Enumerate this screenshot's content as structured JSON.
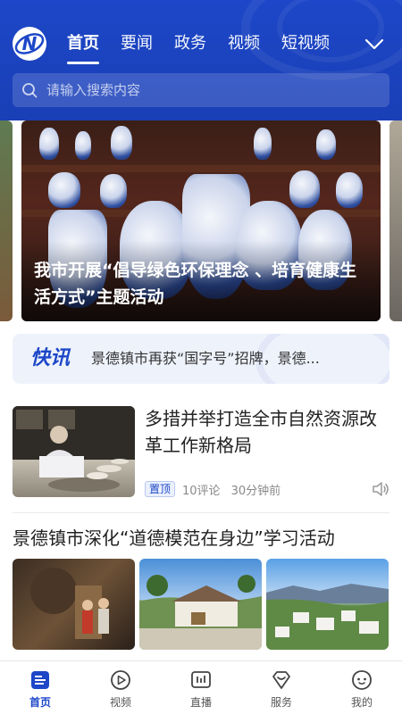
{
  "header": {
    "logo_icon": "channel-logo-icon",
    "nav": [
      {
        "label": "首页",
        "active": true
      },
      {
        "label": "要闻",
        "active": false
      },
      {
        "label": "政务",
        "active": false
      },
      {
        "label": "视频",
        "active": false
      },
      {
        "label": "短视频",
        "active": false
      }
    ],
    "more_icon": "chevron-down-icon"
  },
  "search": {
    "placeholder": "请输入搜索内容",
    "icon": "search-icon"
  },
  "banner": {
    "caption": "我市开展“倡导绿色环保理念 、培育健康生活方式”主题活动"
  },
  "flash": {
    "tag": "快讯",
    "text": "景德镇市再获“国字号”招牌，景德..."
  },
  "articles": [
    {
      "title": "多措并举打造全市自然资源改革工作新格局",
      "badge": "置顶",
      "comments": "10评论",
      "time": "30分钟前",
      "action_icon": "speaker-icon"
    },
    {
      "title": "景德镇市深化“道德模范在身边”学习活动"
    }
  ],
  "tabbar": [
    {
      "label": "首页",
      "icon": "home-icon",
      "active": true
    },
    {
      "label": "视频",
      "icon": "play-icon",
      "active": false
    },
    {
      "label": "直播",
      "icon": "live-icon",
      "active": false
    },
    {
      "label": "服务",
      "icon": "service-icon",
      "active": false
    },
    {
      "label": "我的",
      "icon": "profile-icon",
      "active": false
    }
  ],
  "colors": {
    "brand": "#1d47c8",
    "header_bg": "#1a3fb6",
    "flash_bg": "#eef2fb"
  }
}
